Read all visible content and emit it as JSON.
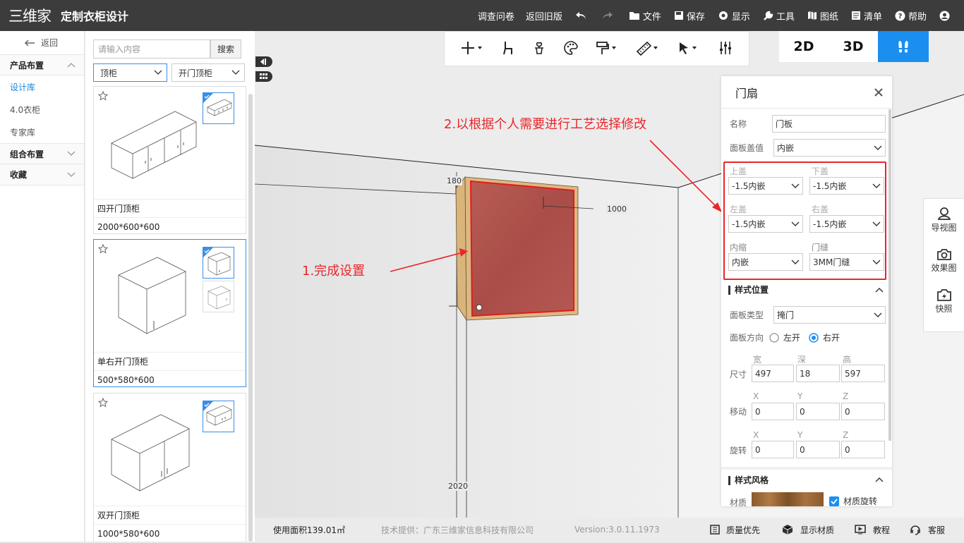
{
  "app": {
    "logo_mark": "三维家",
    "title": "定制衣柜设计"
  },
  "menu": {
    "survey": "调查问卷",
    "old_version": "返回旧版",
    "file": "文件",
    "save": "保存",
    "display": "显示",
    "tools": "工具",
    "drawings": "图纸",
    "list": "清单",
    "help": "帮助"
  },
  "leftnav": {
    "back": "返回",
    "groups": [
      {
        "label": "产品布置",
        "items": [
          "设计库",
          "4.0衣柜",
          "专家库"
        ]
      },
      {
        "label": "组合布置"
      },
      {
        "label": "收藏"
      }
    ]
  },
  "catalog": {
    "search_placeholder": "请输入内容",
    "search_button": "搜索",
    "filter1": "顶柜",
    "filter2": "开门顶柜",
    "products": [
      {
        "name": "四开门顶柜",
        "size": "2000*600*600"
      },
      {
        "name": "单右开门顶柜",
        "size": "500*580*600"
      },
      {
        "name": "双开门顶柜",
        "size": "1000*580*600"
      }
    ]
  },
  "views": {
    "v2d": "2D",
    "v3d": "3D"
  },
  "sidepanel": {
    "nav": "导视图",
    "render": "效果图",
    "snapshot": "快照"
  },
  "scene": {
    "dims": {
      "d180": "180",
      "d1000": "1000",
      "d2020": "2020"
    },
    "annotation1": "1.完成设置",
    "annotation2": "2.以根据个人需要进行工艺选择修改"
  },
  "panel": {
    "title": "门扇",
    "name_label": "名称",
    "name_value": "门板",
    "cover_label": "面板盖值",
    "cover_value": "内嵌",
    "top_label": "上盖",
    "top_value": "-1.5内嵌",
    "bottom_label": "下盖",
    "bottom_value": "-1.5内嵌",
    "left_label": "左盖",
    "left_value": "-1.5内嵌",
    "right_label": "右盖",
    "right_value": "-1.5内嵌",
    "inset_label": "内缩",
    "inset_value": "内嵌",
    "gap_label": "门缝",
    "gap_value": "3MM门缝",
    "style_pos": "样式位置",
    "panel_type_label": "面板类型",
    "panel_type_value": "掩门",
    "direction_label": "面板方向",
    "dir_left": "左开",
    "dir_right": "右开",
    "dir_selected": "right",
    "size_label": "尺寸",
    "w_label": "宽",
    "d_label": "深",
    "h_label": "高",
    "w": "497",
    "d": "18",
    "h": "597",
    "move_label": "移动",
    "rotate_label": "旋转",
    "x": "X",
    "y": "Y",
    "z": "Z",
    "move": [
      "0",
      "0",
      "0"
    ],
    "rotate": [
      "0",
      "0",
      "0"
    ],
    "style_section": "样式风格",
    "material_label": "材质",
    "material_rotate": "材质旋转",
    "material_rotate_checked": true
  },
  "footer": {
    "area": "使用面积139.01㎡",
    "provider": "技术提供：广东三维家信息科技有限公司",
    "version": "Version:3.0.11.1973",
    "quality": "质量优先",
    "show_material": "显示材质",
    "tutorial": "教程",
    "service": "客服"
  },
  "colors": {
    "accent": "#1a8ff0",
    "annotation": "#e8262b",
    "door": "#b2524c",
    "topbar": "#3c3c3c"
  }
}
